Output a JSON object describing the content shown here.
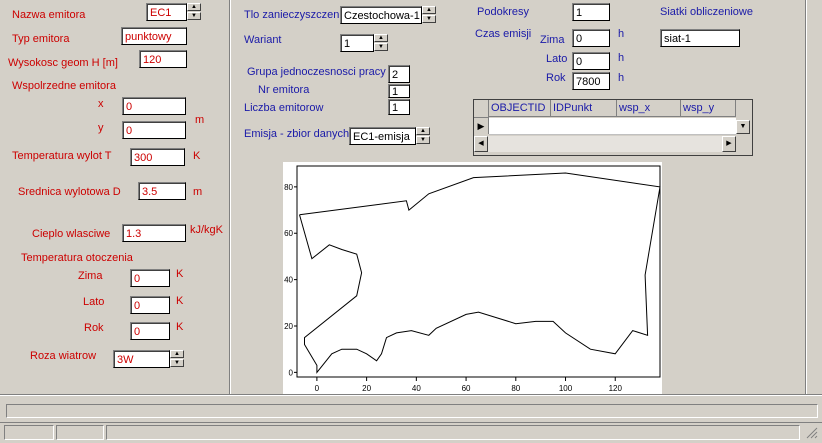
{
  "left": {
    "nazwa_label": "Nazwa emitora",
    "nazwa_value": "EC1",
    "typ_label": "Typ emitora",
    "typ_value": "punktowy",
    "wysokosc_label": "Wysokosc geom H [m]",
    "wysokosc_value": "120",
    "wspolrzedne_label": "Wspolrzedne emitora",
    "x_label": "x",
    "x_value": "0",
    "y_label": "y",
    "y_value": "0",
    "unit_m": "m",
    "temp_wylot_label": "Temperatura wylot T",
    "temp_wylot_value": "300",
    "unit_K": "K",
    "srednica_label": "Srednica  wylotowa D",
    "srednica_value": "3.5",
    "cieplo_label": "Cieplo wlasciwe",
    "cieplo_value": "1.3",
    "unit_kJ": "kJ/kgK",
    "temp_otoczenia_label": "Temperatura otoczenia",
    "zima_label": "Zima",
    "zima_value": "0",
    "lato_label": "Lato",
    "lato_value": "0",
    "rok_label": "Rok",
    "rok_value": "0",
    "roza_label": "Roza wiatrow",
    "roza_value": "3W"
  },
  "middle": {
    "tlo_label": "Tlo zanieczyszczen",
    "tlo_value": "Czestochowa-1",
    "wariant_label": "Wariant",
    "wariant_value": "1",
    "grupa_label": "Grupa jednoczesnosci pracy",
    "grupa_value": "2",
    "nr_label": "Nr emitora",
    "nr_value": "1",
    "liczba_label": "Liczba emitorow",
    "liczba_value": "1",
    "emisja_label": "Emisja - zbior danych",
    "emisja_value": "EC1-emisja"
  },
  "right": {
    "podokresy_label": "Podokresy",
    "podokresy_value": "1",
    "czas_label": "Czas emisji",
    "zima_label": "Zima",
    "zima_value": "0",
    "lato_label": "Lato",
    "lato_value": "0",
    "rok_label": "Rok",
    "rok_value": "7800",
    "unit_h": "h",
    "siatki_label": "Siatki obliczeniowe",
    "siatki_value": "siat-1"
  },
  "grid": {
    "columns": [
      "OBJECTID",
      "IDPunkt",
      "wsp_x",
      "wsp_y"
    ]
  },
  "chart_data": {
    "type": "line",
    "x_ticks": [
      "0",
      "20",
      "40",
      "60",
      "80",
      "100",
      "120"
    ],
    "y_ticks": [
      "0",
      "20",
      "40",
      "60",
      "80"
    ],
    "xlim": [
      -8,
      138
    ],
    "ylim": [
      -2,
      89
    ],
    "series": [
      {
        "points": [
          [
            -7,
            68
          ],
          [
            36,
            74
          ],
          [
            37,
            70
          ],
          [
            45,
            77
          ],
          [
            63,
            84
          ],
          [
            100,
            86
          ],
          [
            138,
            80
          ],
          [
            132,
            42
          ],
          [
            133,
            16
          ],
          [
            127,
            18
          ],
          [
            120,
            8
          ],
          [
            110,
            10
          ],
          [
            100,
            17
          ],
          [
            95,
            22
          ],
          [
            88,
            22
          ],
          [
            80,
            21
          ],
          [
            65,
            26
          ],
          [
            60,
            25
          ],
          [
            48,
            19
          ],
          [
            45,
            16
          ],
          [
            38,
            18
          ],
          [
            32,
            17
          ],
          [
            28,
            15
          ],
          [
            26,
            8
          ],
          [
            24,
            5
          ],
          [
            20,
            8
          ],
          [
            16,
            10
          ],
          [
            10,
            10
          ],
          [
            6,
            8
          ],
          [
            0,
            0
          ],
          [
            0,
            3
          ],
          [
            -5,
            12
          ],
          [
            -5,
            15
          ],
          [
            16,
            33
          ],
          [
            18,
            43
          ],
          [
            16,
            51
          ],
          [
            10,
            53
          ],
          [
            5,
            55
          ],
          [
            -2,
            49
          ],
          [
            -7,
            68
          ]
        ]
      }
    ]
  },
  "icons": {
    "spin_up": "▲",
    "spin_down": "▼",
    "row_pointer": "▶",
    "scroll_left": "◀",
    "scroll_right": "▶"
  }
}
